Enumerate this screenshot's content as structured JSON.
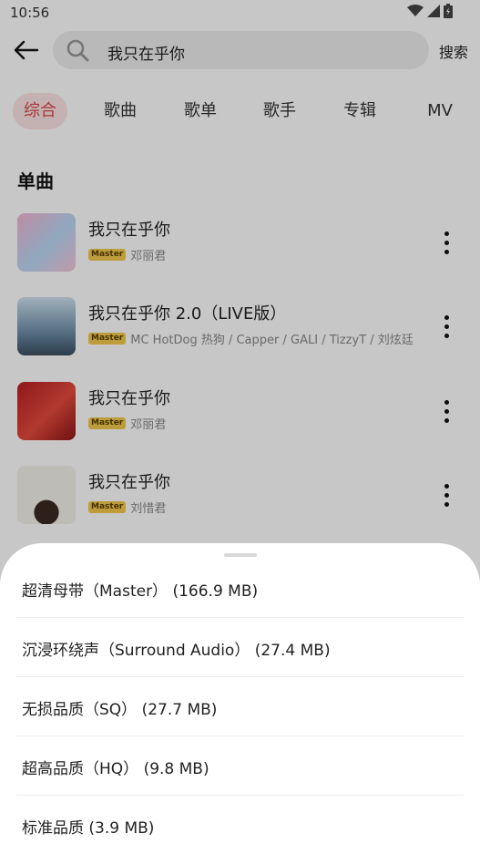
{
  "status": {
    "time": "10:56"
  },
  "search": {
    "query": "我只在乎你",
    "button": "搜索"
  },
  "tabs": [
    {
      "label": "综合",
      "active": true
    },
    {
      "label": "歌曲"
    },
    {
      "label": "歌单"
    },
    {
      "label": "歌手"
    },
    {
      "label": "专辑"
    },
    {
      "label": "MV"
    }
  ],
  "section": {
    "title": "单曲"
  },
  "songs": [
    {
      "title": "我只在乎你",
      "badge": "Master",
      "artist": "邓丽君"
    },
    {
      "title": "我只在乎你 2.0（LIVE版）",
      "badge": "Master",
      "artist": "MC HotDog 热狗 / Capper / GALI / TizzyT / 刘炫廷"
    },
    {
      "title": "我只在乎你",
      "badge": "Master",
      "artist": "邓丽君"
    },
    {
      "title": "我只在乎你",
      "badge": "Master",
      "artist": "刘惜君"
    }
  ],
  "quality_sheet": {
    "options": [
      {
        "label": "超清母带（Master） (166.9 MB)"
      },
      {
        "label": "沉浸环绕声（Surround Audio） (27.4 MB)"
      },
      {
        "label": "无损品质（SQ） (27.7 MB)"
      },
      {
        "label": "超高品质（HQ） (9.8 MB)"
      },
      {
        "label": "标准品质 (3.9 MB)"
      }
    ]
  },
  "colors": {
    "accent": "#d94a4a",
    "tab_active_bg": "#fbe3e3",
    "badge": "#f2c94c"
  }
}
